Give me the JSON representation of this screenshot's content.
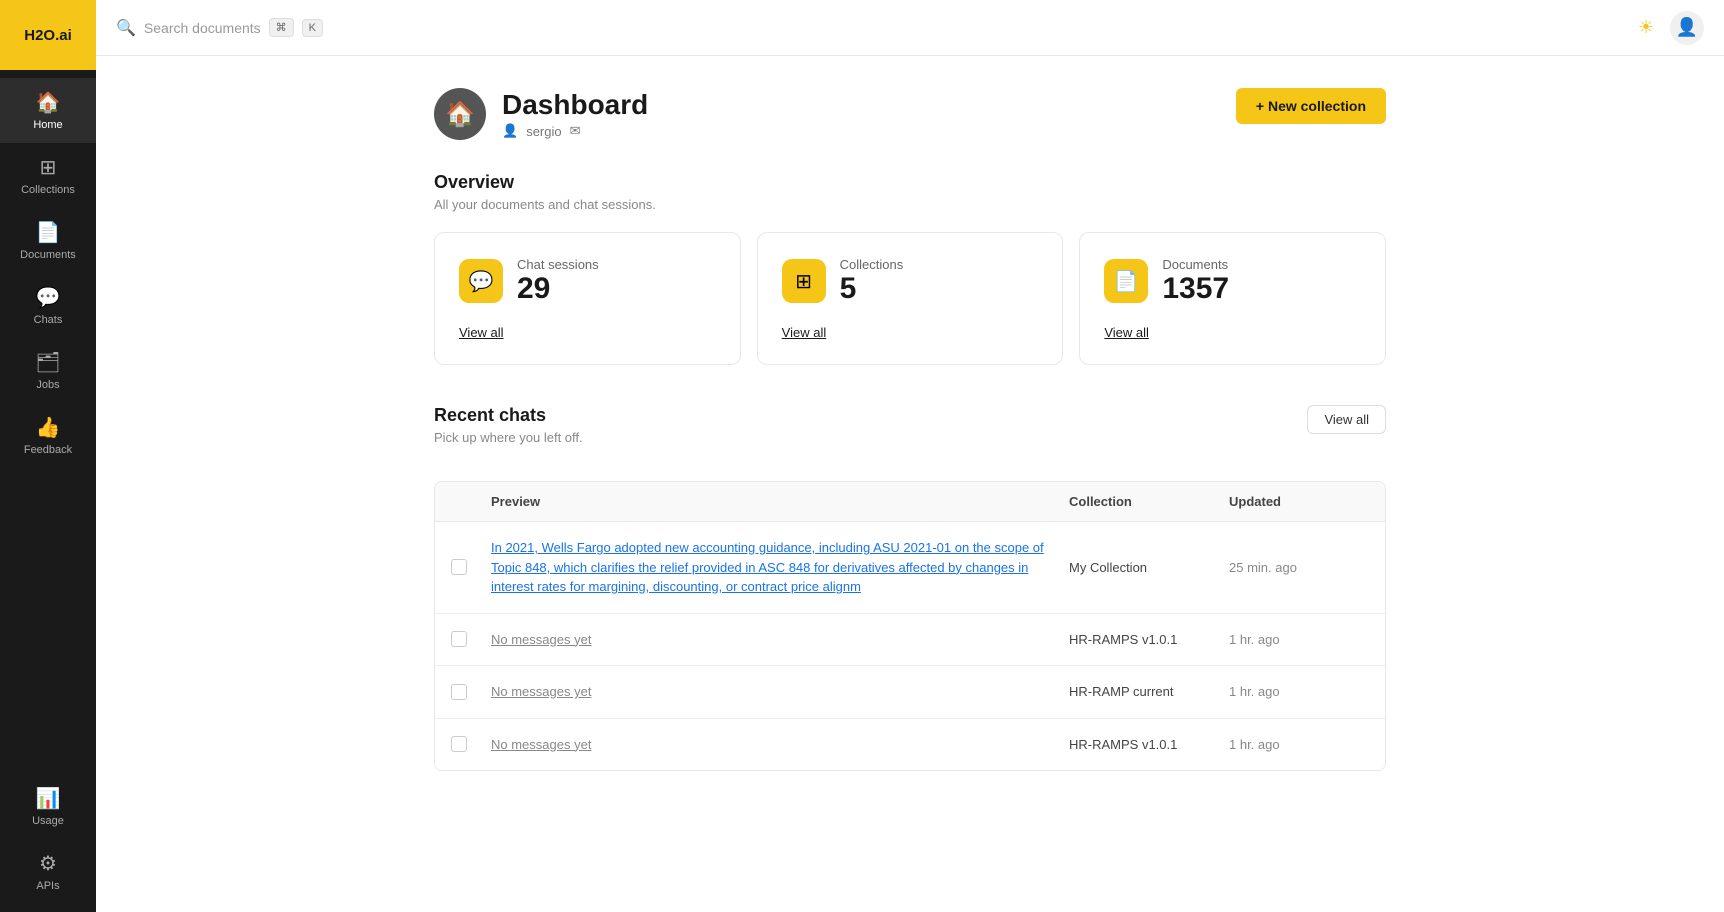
{
  "sidebar": {
    "logo": "H2O.ai",
    "items": [
      {
        "id": "home",
        "label": "Home",
        "icon": "🏠",
        "active": true
      },
      {
        "id": "collections",
        "label": "Collections",
        "icon": "⊞"
      },
      {
        "id": "documents",
        "label": "Documents",
        "icon": "📄"
      },
      {
        "id": "chats",
        "label": "Chats",
        "icon": "💬"
      },
      {
        "id": "jobs",
        "label": "Jobs",
        "icon": "🗂"
      },
      {
        "id": "feedback",
        "label": "Feedback",
        "icon": "👍"
      }
    ],
    "bottom_items": [
      {
        "id": "usage",
        "label": "Usage",
        "icon": "📊"
      },
      {
        "id": "apis",
        "label": "APIs",
        "icon": "⚙"
      }
    ]
  },
  "topbar": {
    "search_placeholder": "Search documents",
    "kbd1": "⌘",
    "kbd2": "K"
  },
  "page": {
    "icon": "🏠",
    "title": "Dashboard",
    "meta_user": "sergio",
    "meta_email_icon": "✉",
    "new_collection_label": "+ New collection"
  },
  "overview": {
    "title": "Overview",
    "subtitle": "All your documents and chat sessions.",
    "stats": [
      {
        "id": "chat-sessions",
        "icon": "💬",
        "label": "Chat sessions",
        "value": "29",
        "view_all": "View all"
      },
      {
        "id": "collections",
        "icon": "⊞",
        "label": "Collections",
        "value": "5",
        "view_all": "View all"
      },
      {
        "id": "documents",
        "icon": "📄",
        "label": "Documents",
        "value": "1357",
        "view_all": "View all"
      }
    ]
  },
  "recent_chats": {
    "title": "Recent chats",
    "subtitle": "Pick up where you left off.",
    "view_all": "View all",
    "columns": [
      "",
      "Preview",
      "Collection",
      "Updated"
    ],
    "rows": [
      {
        "preview": "In 2021, Wells Fargo adopted new accounting guidance, including ASU 2021-01 on the scope of Topic 848, which clarifies the relief provided in ASC 848 for derivatives affected by changes in interest rates for margining, discounting, or contract price alignm",
        "collection": "My Collection",
        "updated": "25 min. ago",
        "is_link": true
      },
      {
        "preview": "No messages yet",
        "collection": "HR-RAMPS v1.0.1",
        "updated": "1 hr. ago",
        "is_link": false
      },
      {
        "preview": "No messages yet",
        "collection": "HR-RAMP current",
        "updated": "1 hr. ago",
        "is_link": false
      },
      {
        "preview": "No messages yet",
        "collection": "HR-RAMPS v1.0.1",
        "updated": "1 hr. ago",
        "is_link": false
      }
    ]
  }
}
